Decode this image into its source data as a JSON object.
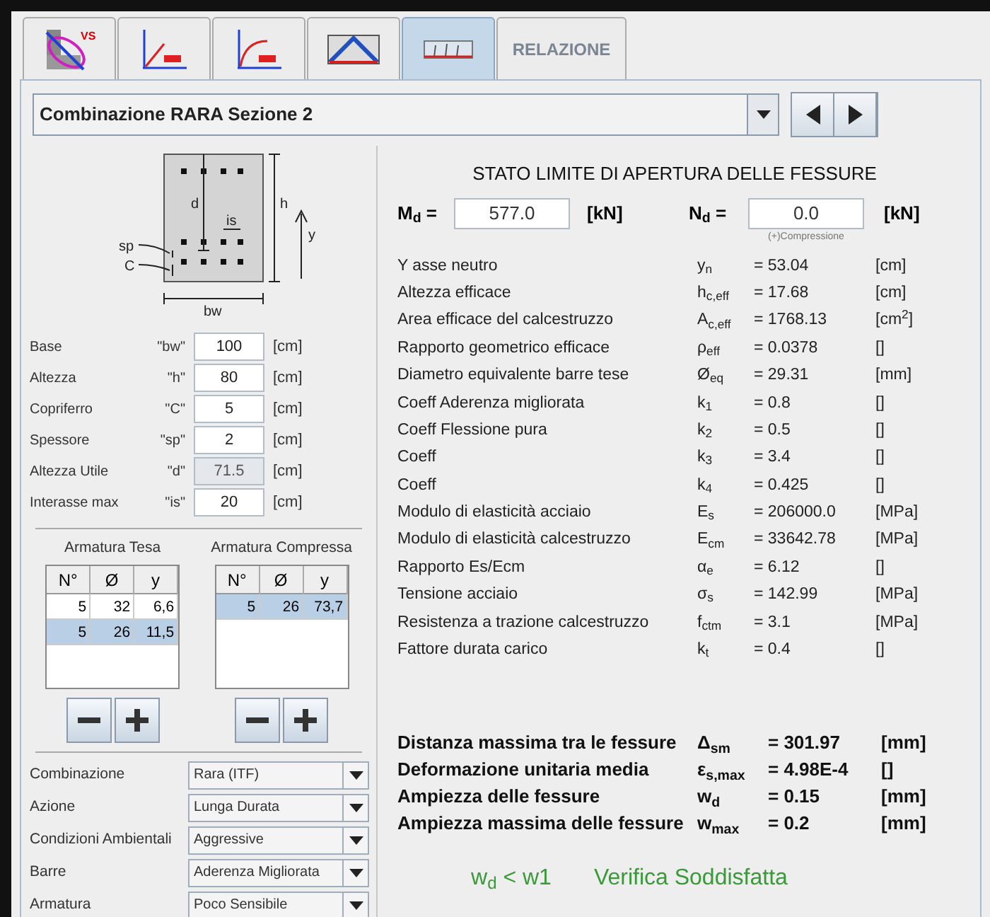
{
  "tabs": [
    {
      "kind": "icon",
      "caption": "VS",
      "selected": false
    },
    {
      "kind": "icon",
      "selected": false
    },
    {
      "kind": "icon",
      "selected": false
    },
    {
      "kind": "icon",
      "selected": false
    },
    {
      "kind": "icon",
      "selected": true
    },
    {
      "kind": "text",
      "label": "RELAZIONE",
      "selected": false
    }
  ],
  "combination_select": {
    "value": "Combinazione RARA Sezione 2"
  },
  "section_diagram": {
    "labels": [
      "d",
      "h",
      "is",
      "y",
      "sp",
      "C",
      "bw"
    ]
  },
  "geometry_fields": [
    {
      "label": "Base",
      "symbol": "\"bw\"",
      "value": "100",
      "unit": "[cm]",
      "disabled": false
    },
    {
      "label": "Altezza",
      "symbol": "\"h\"",
      "value": "80",
      "unit": "[cm]",
      "disabled": false
    },
    {
      "label": "Copriferro",
      "symbol": "\"C\"",
      "value": "5",
      "unit": "[cm]",
      "disabled": false
    },
    {
      "label": "Spessore",
      "symbol": "\"sp\"",
      "value": "2",
      "unit": "[cm]",
      "disabled": false
    },
    {
      "label": "Altezza Utile",
      "symbol": "\"d\"",
      "value": "71.5",
      "unit": "[cm]",
      "disabled": true
    },
    {
      "label": "Interasse max",
      "symbol": "\"is\"",
      "value": "20",
      "unit": "[cm]",
      "disabled": false
    }
  ],
  "rebar_tables": [
    {
      "title": "Armatura Tesa",
      "columns": [
        "N°",
        "Ø",
        "y"
      ],
      "rows": [
        {
          "cells": [
            "5",
            "32",
            "6,6"
          ],
          "selected": false
        },
        {
          "cells": [
            "5",
            "26",
            "11,5"
          ],
          "selected": true
        }
      ]
    },
    {
      "title": "Armatura Compressa",
      "columns": [
        "N°",
        "Ø",
        "y"
      ],
      "rows": [
        {
          "cells": [
            "5",
            "26",
            "73,7"
          ],
          "selected": true
        }
      ]
    }
  ],
  "options": [
    {
      "label": "Combinazione",
      "value": "Rara (ITF)"
    },
    {
      "label": "Azione",
      "value": "Lunga Durata"
    },
    {
      "label": "Condizioni Ambientali",
      "value": "Aggressive"
    },
    {
      "label": "Barre",
      "value": "Aderenza Migliorata"
    },
    {
      "label": "Armatura",
      "value": "Poco Sensibile"
    }
  ],
  "results": {
    "title": "STATO LIMITE DI APERTURA DELLE FESSURE",
    "md": {
      "label": "M$_{d}$ =",
      "value": "577.0",
      "unit": "[kN]"
    },
    "nd": {
      "label": "N$_{d}$ =",
      "value": "0.0",
      "unit": "[kN]",
      "note": "(+)Compressione"
    },
    "rows": [
      {
        "label": "Y asse neutro",
        "symbol": "y$_{n}$",
        "value": "= 53.04",
        "unit": "[cm]"
      },
      {
        "label": "Altezza efficace",
        "symbol": "h$_{c,eff}$",
        "value": "= 17.68",
        "unit": "[cm]"
      },
      {
        "label": "Area efficace del calcestruzzo",
        "symbol": "A$_{c,eff}$",
        "value": "= 1768.13",
        "unit": "[cm$^{2}$]"
      },
      {
        "label": "Rapporto geometrico efficace",
        "symbol": "ρ$_{eff}$",
        "value": "= 0.0378",
        "unit": "[]"
      },
      {
        "label": "Diametro equivalente barre tese",
        "symbol": "Ø$_{eq}$",
        "value": "= 29.31",
        "unit": "[mm]"
      },
      {
        "label": "Coeff Aderenza migliorata",
        "symbol": "k$_{1}$",
        "value": "= 0.8",
        "unit": "[]"
      },
      {
        "label": "Coeff Flessione pura",
        "symbol": "k$_{2}$",
        "value": "= 0.5",
        "unit": "[]"
      },
      {
        "label": "Coeff",
        "symbol": "k$_{3}$",
        "value": "= 3.4",
        "unit": "[]"
      },
      {
        "label": "Coeff",
        "symbol": "k$_{4}$",
        "value": "= 0.425",
        "unit": "[]"
      },
      {
        "label": "Modulo di elasticità acciaio",
        "symbol": "E$_{s}$",
        "value": "= 206000.0",
        "unit": "[MPa]"
      },
      {
        "label": "Modulo di elasticità calcestruzzo",
        "symbol": "E$_{cm}$",
        "value": "= 33642.78",
        "unit": "[MPa]"
      },
      {
        "label": "Rapporto Es/Ecm",
        "symbol": "α$_{e}$",
        "value": "= 6.12",
        "unit": "[]"
      },
      {
        "label": "Tensione acciaio",
        "symbol": "σ$_{s}$",
        "value": "= 142.99",
        "unit": "[MPa]"
      },
      {
        "label": "Resistenza a trazione calcestruzzo",
        "symbol": "f$_{ctm}$",
        "value": "= 3.1",
        "unit": "[MPa]"
      },
      {
        "label": "Fattore durata carico",
        "symbol": "k$_{t}$",
        "value": "= 0.4",
        "unit": "[]"
      }
    ],
    "summary": [
      {
        "label": "Distanza massima tra le fessure",
        "symbol": "Δ$_{sm}$",
        "value": "= 301.97",
        "unit": "[mm]"
      },
      {
        "label": "Deformazione unitaria media",
        "symbol": "ε$_{s,max}$",
        "value": "= 4.98E-4",
        "unit": "[]"
      },
      {
        "label": "Ampiezza delle fessure",
        "symbol": "w$_{d}$",
        "value": "= 0.15",
        "unit": "[mm]"
      },
      {
        "label": "Ampiezza massima delle fessure",
        "symbol": "w$_{max}$",
        "value": "= 0.2",
        "unit": "[mm]"
      }
    ],
    "check": {
      "condition": "w$_{d}$ < w1",
      "verdict": "Verifica Soddisfatta"
    }
  }
}
